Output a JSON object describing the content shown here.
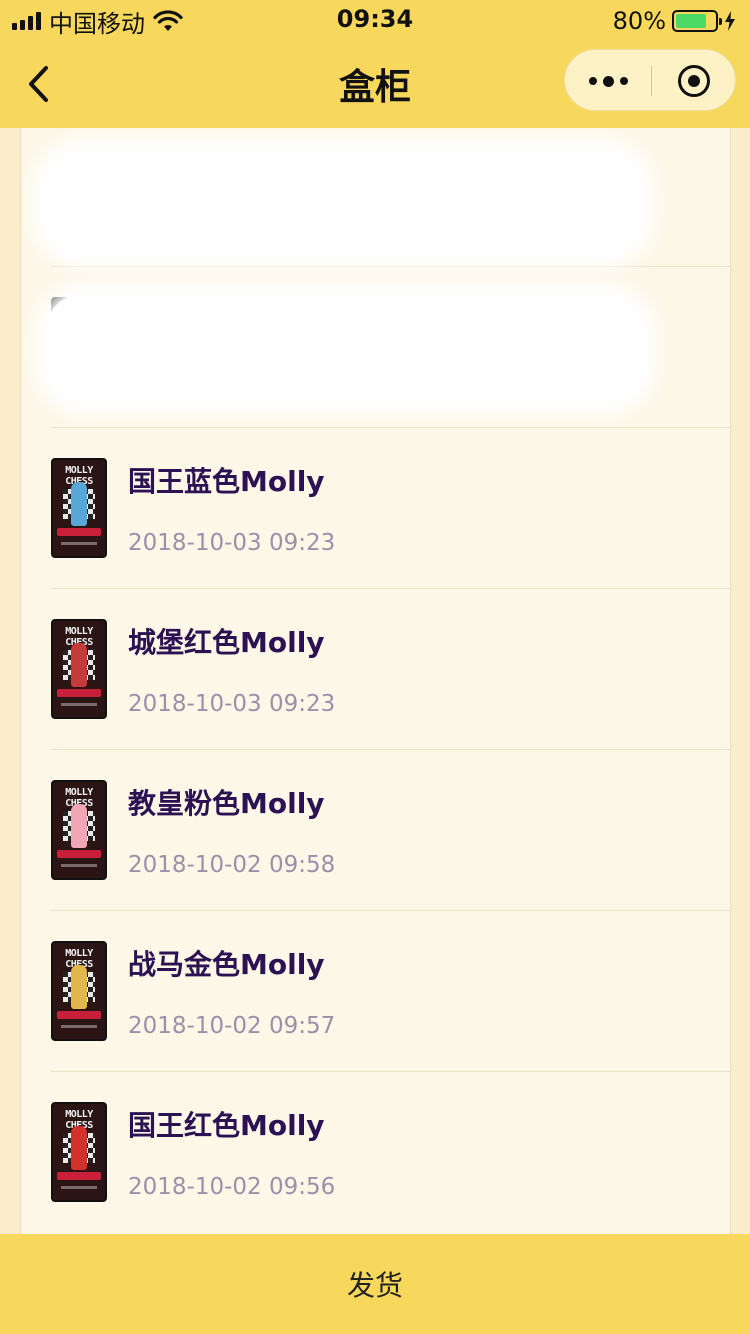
{
  "status_bar": {
    "carrier": "中国移动",
    "time": "09:34",
    "battery_percent": "80%",
    "battery_level": 0.8
  },
  "nav": {
    "title": "盒柜",
    "back_icon": "chevron-left-icon",
    "more_icon": "more-dots-icon",
    "close_icon": "target-circle-icon"
  },
  "items": [
    {
      "name": "国王蓝色Molly",
      "time": "2018-10-03 09:23",
      "doll_color": "#59a7d6",
      "thumb_text": "MOLLY CHESS"
    },
    {
      "name": "城堡红色Molly",
      "time": "2018-10-03 09:23",
      "doll_color": "#c53a3a",
      "thumb_text": "MOLLY CHESS"
    },
    {
      "name": "教皇粉色Molly",
      "time": "2018-10-02 09:58",
      "doll_color": "#f0a6b4",
      "thumb_text": "MOLLY CHESS"
    },
    {
      "name": "战马金色Molly",
      "time": "2018-10-02 09:57",
      "doll_color": "#e3b84a",
      "thumb_text": "MOLLY CHESS"
    },
    {
      "name": "国王红色Molly",
      "time": "2018-10-02 09:56",
      "doll_color": "#d4302c",
      "thumb_text": "MOLLY CHESS"
    }
  ],
  "footer": {
    "ship_label": "发货"
  },
  "colors": {
    "header_bg": "#f7d75c",
    "card_bg": "#fdf7e8",
    "name_color": "#2c1153",
    "time_color": "#9a90a8"
  }
}
